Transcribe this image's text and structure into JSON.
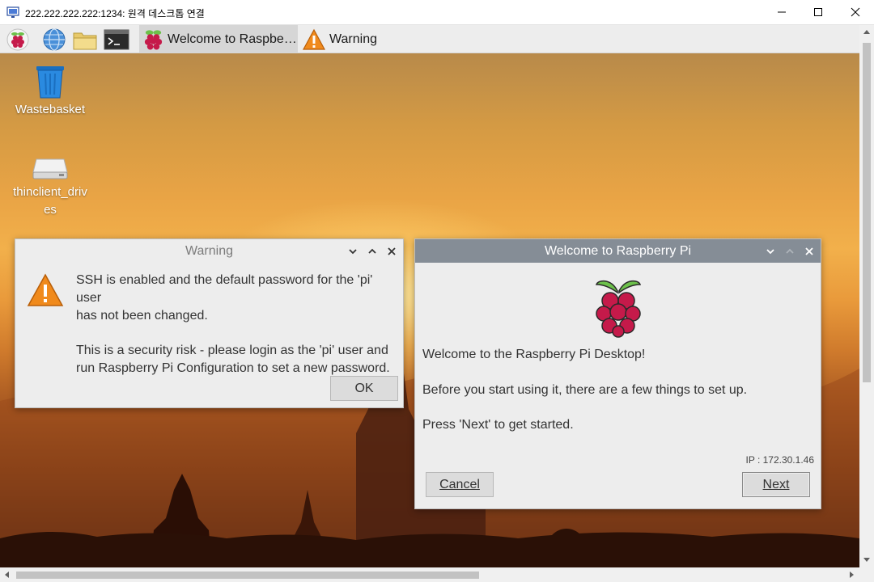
{
  "window": {
    "title": "222.222.222.222:1234: 원격 데스크톱 연결"
  },
  "taskbar": {
    "tasks": [
      {
        "label": "Welcome to Raspberr...",
        "icon": "raspberry-icon",
        "active": true
      },
      {
        "label": "Warning",
        "icon": "warning-triangle-icon",
        "active": false
      }
    ],
    "launchers": [
      "raspberry-menu-icon",
      "web-browser-icon",
      "file-manager-icon",
      "terminal-icon"
    ]
  },
  "desktop": {
    "icons": [
      {
        "label_line1": "Wastebasket",
        "icon": "wastebasket-icon"
      },
      {
        "label_line1": "thinclient_driv",
        "label_line2": "es",
        "icon": "drive-icon"
      }
    ]
  },
  "warning_dialog": {
    "title": "Warning",
    "line1": "SSH is enabled and the default password for the 'pi' user",
    "line2": "has not been changed.",
    "line3": "This is a security risk - please login as the 'pi' user and",
    "line4": "run Raspberry Pi Configuration to set a new password.",
    "ok_label": "OK"
  },
  "welcome_dialog": {
    "title": "Welcome to Raspberry Pi",
    "line1": "Welcome to the Raspberry Pi Desktop!",
    "line2": "Before you start using it, there are a few things to set up.",
    "line3": "Press 'Next' to get started.",
    "ip": "IP : 172.30.1.46",
    "cancel_label": "Cancel",
    "next_label": "Next"
  },
  "colors": {
    "titlebar_active": "#858d96",
    "dialog_bg": "#ededed",
    "warning_orange": "#f08a1c",
    "raspberry_red": "#c51a4a",
    "leaf_green": "#6cc04a"
  }
}
